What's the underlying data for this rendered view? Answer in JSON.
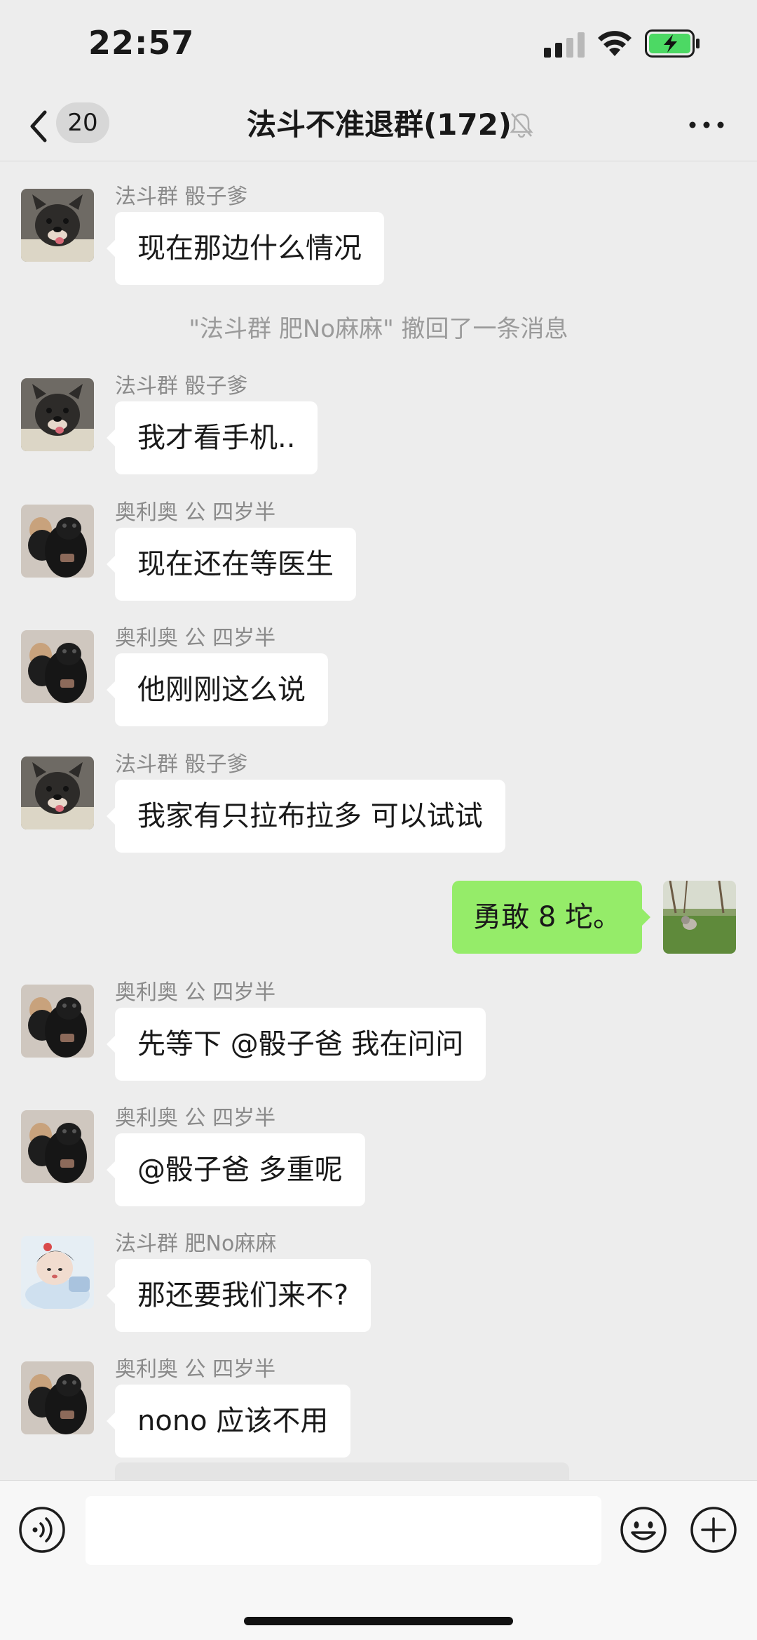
{
  "status_bar": {
    "time": "22:57"
  },
  "nav": {
    "unread_count": "20",
    "title": "法斗不准退群(172)"
  },
  "messages": [
    {
      "sender": "法斗群 骰子爹",
      "text": "现在那边什么情况",
      "avatar": "french-bulldog"
    },
    {
      "sender": "法斗群 骰子爹",
      "text": "我才看手机..",
      "avatar": "french-bulldog"
    },
    {
      "sender": "奥利奥 公 四岁半",
      "text": " 现在还在等医生",
      "avatar": "black-dog"
    },
    {
      "sender": "奥利奥 公 四岁半",
      "text": "他刚刚这么说",
      "avatar": "black-dog"
    },
    {
      "sender": "法斗群 骰子爹",
      "text": "我家有只拉布拉多 可以试试",
      "avatar": "french-bulldog"
    },
    {
      "sender": "奥利奥 公 四岁半",
      "text": "先等下 @骰子爸  我在问问",
      "avatar": "black-dog"
    },
    {
      "sender": "奥利奥 公 四岁半",
      "text": "@骰子爸 多重呢",
      "avatar": "black-dog"
    },
    {
      "sender": "法斗群 肥No麻麻",
      "text": "那还要我们来不?",
      "avatar": "figure-illustration"
    },
    {
      "sender": "奥利奥 公 四岁半",
      "text": "nono 应该不用",
      "avatar": "black-dog"
    }
  ],
  "system_notice": "\"法斗群 肥No麻麻\" 撤回了一条消息",
  "self_message": {
    "text": "勇敢 8 坨。",
    "avatar": "dog-on-grass"
  },
  "input": {
    "value": ""
  },
  "colors": {
    "background": "#ededed",
    "self_bubble": "#95ec69",
    "other_bubble": "#ffffff",
    "battery_fill": "#4cd964"
  }
}
